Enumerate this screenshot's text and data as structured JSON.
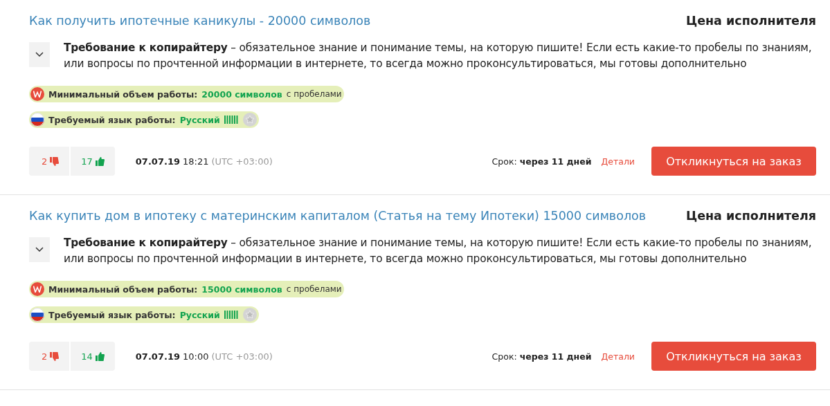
{
  "orders": [
    {
      "title": "Как получить ипотечные каникулы - 20000 символов",
      "price_label": "Цена исполнителя",
      "description": "**Требование к копирайтеру** – обязательное знание и понимание темы, на которую пишите! Если есть какие-то пробелы по знаниям, или вопросы по прочтенной информации в интернете, то всегда можно проконсультироваться, мы готовы дополнительно",
      "volume": {
        "label": "Минимальный объем работы:",
        "value": "20000 символов",
        "suffix": "с пробелами"
      },
      "language": {
        "label": "Требуемый язык работы:",
        "value": "Русский"
      },
      "dislikes": "2",
      "likes": "17",
      "date": "07.07.19",
      "time": "18:21",
      "timezone": "(UTC +03:00)",
      "term_label": "Срок:",
      "term_value": "через 11 дней",
      "details_link": "Детали",
      "respond_button": "Откликнуться на заказ"
    },
    {
      "title": "Как купить дом в ипотеку с материнским капиталом (Статья на тему Ипотеки) 15000 символов",
      "price_label": "Цена исполнителя",
      "description": "**Требование к копирайтеру** – обязательное знание и понимание темы, на которую пишите! Если есть какие-то пробелы по знаниям, или вопросы по прочтенной информации в интернете, то всегда можно проконсультироваться, мы готовы дополнительно",
      "volume": {
        "label": "Минимальный объем работы:",
        "value": "15000 символов",
        "suffix": "с пробелами"
      },
      "language": {
        "label": "Требуемый язык работы:",
        "value": "Русский"
      },
      "dislikes": "2",
      "likes": "14",
      "date": "07.07.19",
      "time": "10:00",
      "timezone": "(UTC +03:00)",
      "term_label": "Срок:",
      "term_value": "через 11 дней",
      "details_link": "Детали",
      "respond_button": "Откликнуться на заказ"
    }
  ]
}
